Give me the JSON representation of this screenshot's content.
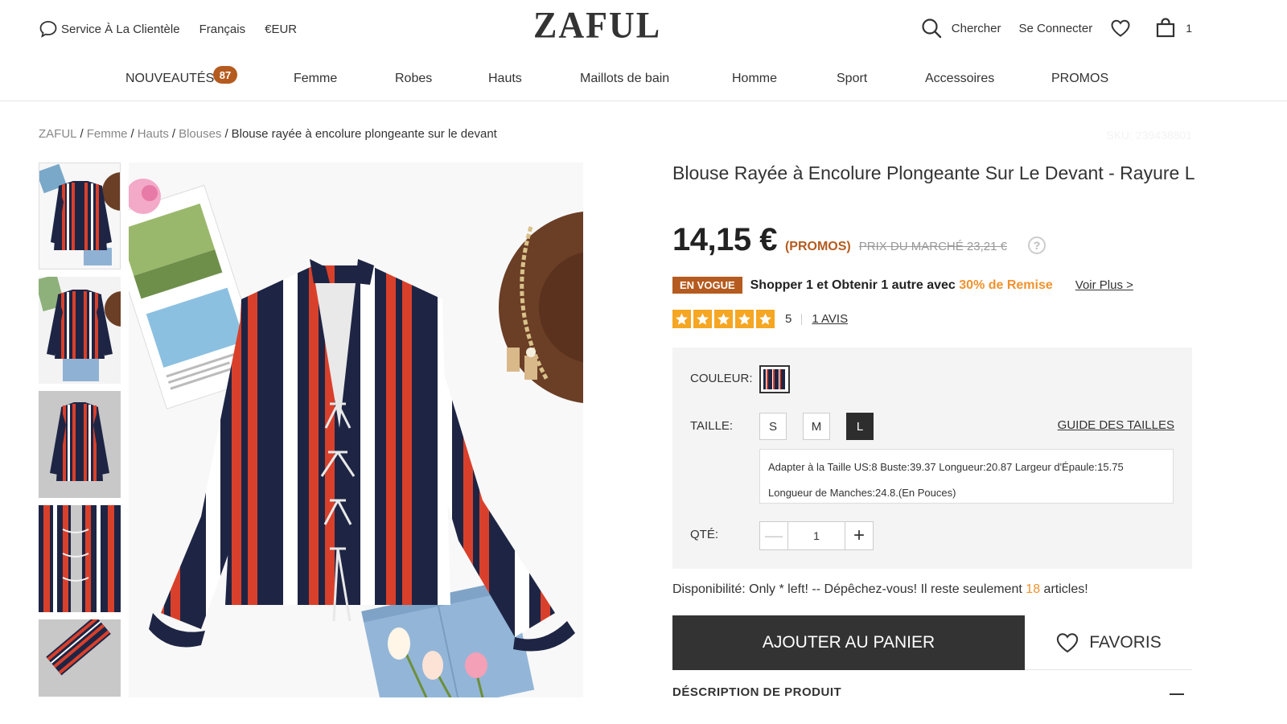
{
  "top_bar": {
    "service": "Service À La Clientèle",
    "language": "Français",
    "currency": "€EUR",
    "logo": "ZAFUL",
    "search": "Chercher",
    "login": "Se Connecter",
    "cart_count": "1"
  },
  "nav": {
    "items": [
      "NOUVEAUTÉS",
      "Femme",
      "Robes",
      "Hauts",
      "Maillots de bain",
      "Homme",
      "Sport",
      "Accessoires",
      "PROMOS"
    ],
    "new_badge": "87"
  },
  "breadcrumb": {
    "items": [
      "ZAFUL",
      "Femme",
      "Hauts",
      "Blouses"
    ],
    "current": "Blouse rayée à encolure plongeante sur le devant",
    "sku": "SKU: 239438801"
  },
  "product": {
    "title": "Blouse Rayée à Encolure Plongeante Sur Le Devant - Rayure L",
    "price": "14,15 €",
    "promo_label": "(PROMOS)",
    "market_price": "PRIX DU MARCHÉ 23,21 €",
    "help": "?",
    "vogue_badge": "EN VOGUE",
    "promo_text": "Shopper 1 et Obtenir 1 autre avec ",
    "promo_accent": "30% de Remise",
    "voir_plus": "Voir Plus >",
    "rating": "5",
    "reviews": "1 AVIS",
    "stars": 5
  },
  "options": {
    "color_label": "COULEUR:",
    "size_label": "TAILLE:",
    "sizes": [
      "S",
      "M",
      "L"
    ],
    "selected_size": "L",
    "size_guide": "GUIDE DES TAILLES",
    "size_info": "Adapter à la Taille US:8    Buste:39.37    Longueur:20.87    Largeur d'Épaule:15.75    Longueur de Manches:24.8.(En Pouces)",
    "qty_label": "QTÉ:",
    "qty": "1",
    "qty_minus": "—",
    "qty_plus": "+"
  },
  "availability": {
    "text_before": "Disponibilité: Only * left! -- Dépêchez-vous! Il reste seulement ",
    "count": "18",
    "text_after": " articles!"
  },
  "actions": {
    "add_to_cart": "AJOUTER AU PANIER",
    "favorites": "FAVORIS"
  },
  "description": {
    "title": "DÉSCRIPTION DE PRODUIT"
  },
  "colors": {
    "accent_orange": "#f0922d",
    "brand_brown": "#b55b1f",
    "dark_button": "#333333",
    "stripe_navy": "#1e2544",
    "stripe_red": "#d9402b"
  }
}
